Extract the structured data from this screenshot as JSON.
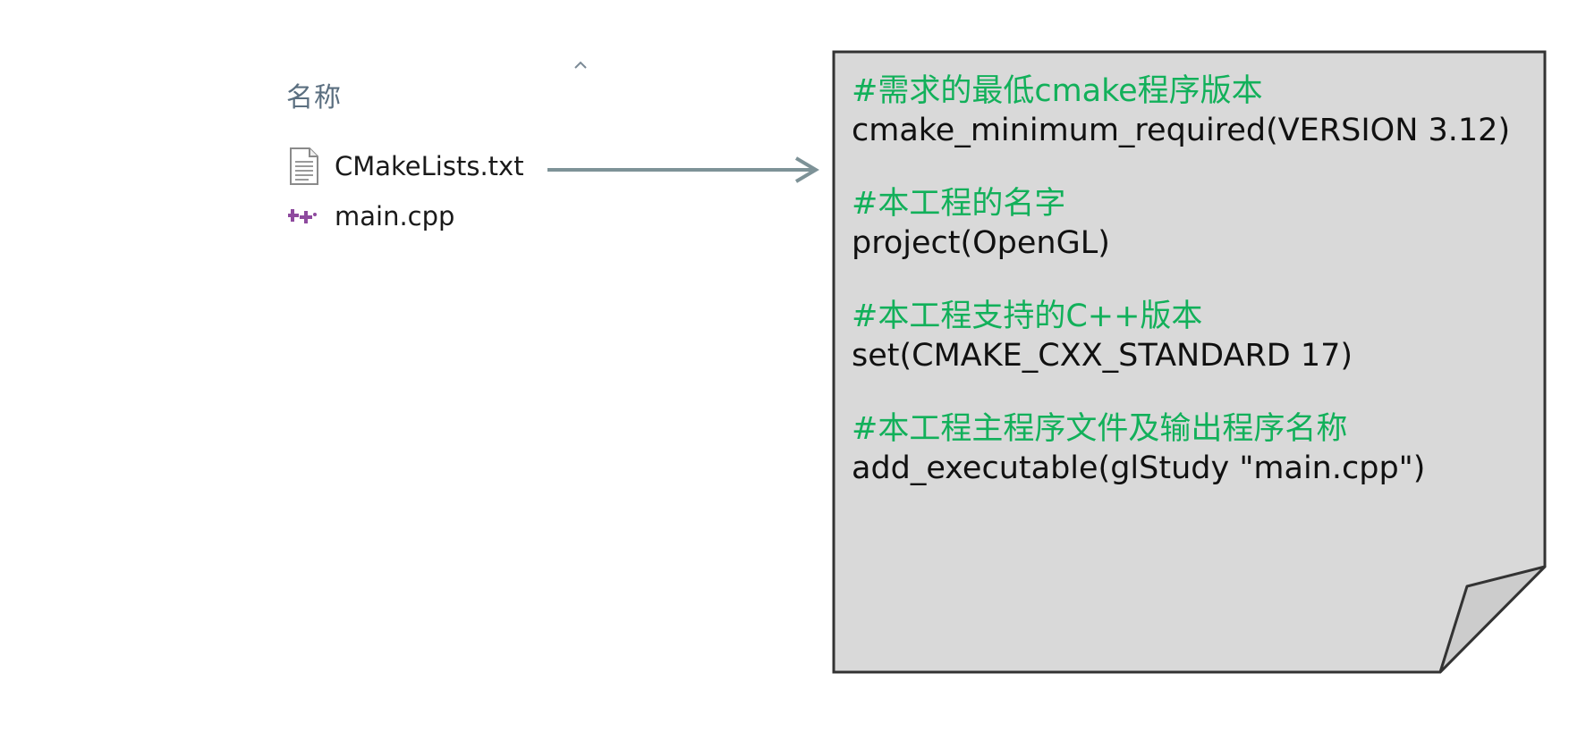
{
  "explorer": {
    "column_header": "名称",
    "sort_icon": "chevron-up-icon",
    "files": [
      {
        "name": "CMakeLists.txt",
        "icon": "text-file-icon"
      },
      {
        "name": "main.cpp",
        "icon": "cpp-file-icon"
      }
    ]
  },
  "arrow": {
    "icon": "arrow-right-icon",
    "color": "#7d9297"
  },
  "note": {
    "background": "#d9d9d9",
    "border": "#333333",
    "comment_color": "#12b05a",
    "code_color": "#111111",
    "blocks": [
      {
        "comment": "#需求的最低cmake程序版本",
        "code": "cmake_minimum_required(VERSION 3.12)"
      },
      {
        "comment": "#本工程的名字",
        "code": "project(OpenGL)"
      },
      {
        "comment": "#本工程支持的C++版本",
        "code": "set(CMAKE_CXX_STANDARD 17)"
      },
      {
        "comment": "#本工程主程序文件及输出程序名称",
        "code": "add_executable(glStudy \"main.cpp\")"
      }
    ]
  }
}
